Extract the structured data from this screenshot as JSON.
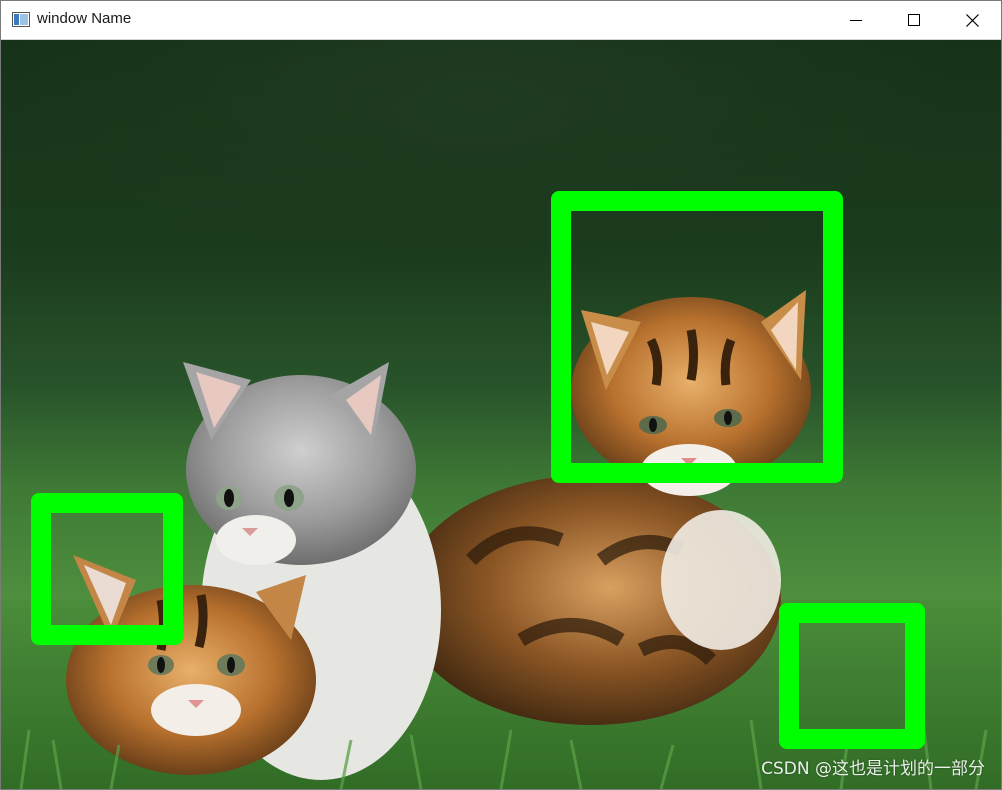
{
  "window": {
    "title": "window Name"
  },
  "colors": {
    "detection_box": "#00ff00"
  },
  "icons": {
    "app": "opencv-window-icon",
    "minimize": "minimize-icon",
    "maximize": "maximize-icon",
    "close": "close-icon"
  },
  "image": {
    "watermark": "CSDN @这也是计划的一部分"
  }
}
